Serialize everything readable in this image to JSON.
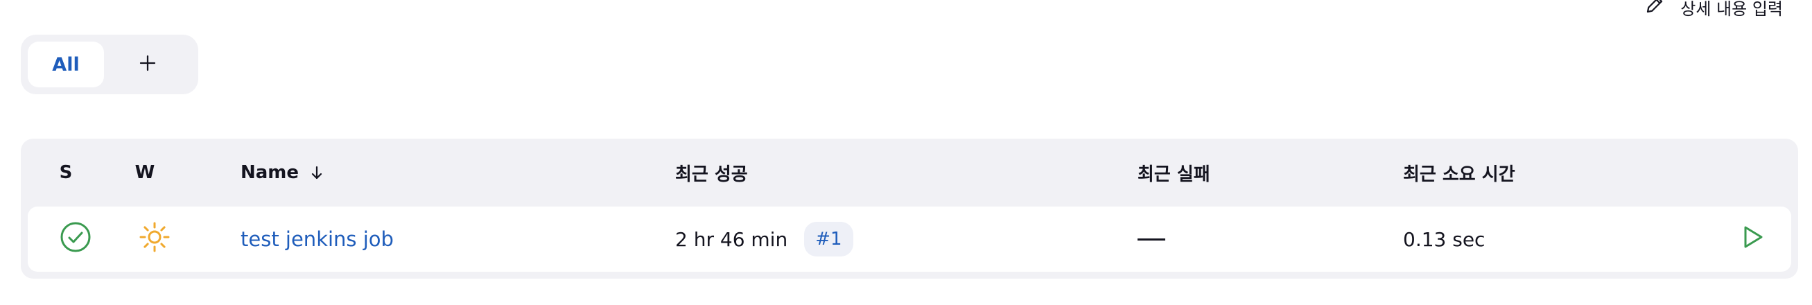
{
  "header": {
    "edit_description_label": "상세 내용 입력"
  },
  "view_tabs": {
    "all_label": "All",
    "add_label": "+"
  },
  "table": {
    "columns": {
      "status": "S",
      "weather": "W",
      "name": "Name",
      "last_success": "최근 성공",
      "last_failure": "최근 실패",
      "last_duration": "최근 소요 시간"
    },
    "rows": [
      {
        "status_icon": "success-check-icon",
        "weather_icon": "sunny-icon",
        "name": "test jenkins job",
        "last_success_time": "2 hr 46 min",
        "last_success_build": "#1",
        "last_failure": "—",
        "last_duration": "0.13 sec",
        "action_icon": "play-icon"
      }
    ]
  },
  "colors": {
    "link": "#1f5dbb",
    "success": "#3a9a4f",
    "weather_sunny": "#f0a92e",
    "panel_bg": "#f1f1f5"
  }
}
